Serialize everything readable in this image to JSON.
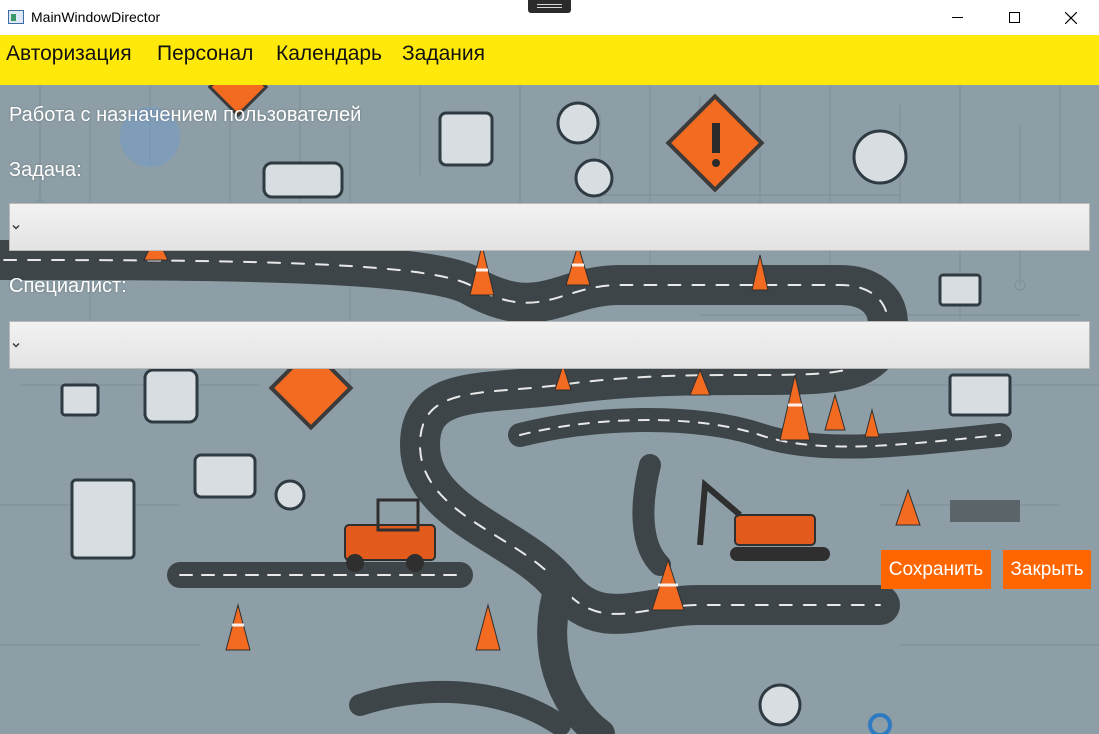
{
  "window": {
    "title": "MainWindowDirector",
    "minimize_icon": "minimize-icon",
    "maximize_icon": "maximize-icon",
    "close_icon": "close-icon"
  },
  "menu": {
    "items": [
      "Авторизация",
      "Персонал",
      "Календарь",
      "Задания"
    ],
    "background": "#ffe90a"
  },
  "form": {
    "heading": "Работа с назначением пользователей",
    "task_label": "Задача:",
    "task_value": "",
    "specialist_label": "Специалист:",
    "specialist_value": ""
  },
  "buttons": {
    "save": "Сохранить",
    "close": "Закрыть",
    "color": "#ff6600"
  }
}
